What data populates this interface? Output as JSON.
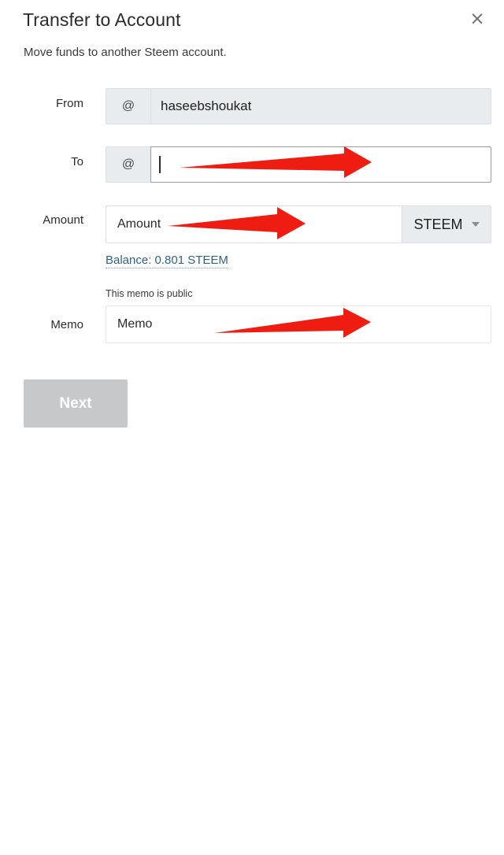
{
  "dialog": {
    "title": "Transfer to Account",
    "subtitle": "Move funds to another Steem account.",
    "close_label": "×"
  },
  "form": {
    "from": {
      "label": "From",
      "prefix": "@",
      "value": "haseebshoukat",
      "state": "disabled"
    },
    "to": {
      "label": "To",
      "prefix": "@",
      "value": "",
      "placeholder": "",
      "state": "focused"
    },
    "amount": {
      "label": "Amount",
      "placeholder": "Amount",
      "value": "",
      "currency": "STEEM",
      "balance_link": "Balance: 0.801 STEEM"
    },
    "memo": {
      "label": "Memo",
      "hint": "This memo is public",
      "placeholder": "Memo",
      "value": ""
    }
  },
  "actions": {
    "next_label": "Next"
  },
  "annotations": {
    "arrow_color": "#ee1c11",
    "arrows": [
      {
        "name": "arrow-to-field",
        "target": "to-input"
      },
      {
        "name": "arrow-amount-field",
        "target": "amount-input"
      },
      {
        "name": "arrow-memo-field",
        "target": "memo-input"
      }
    ]
  },
  "colors": {
    "accent_link": "#2f6189",
    "disabled_button": "#c6c8ca",
    "input_prefix_bg": "#e9ecef",
    "arrow_red": "#ee1c11"
  }
}
